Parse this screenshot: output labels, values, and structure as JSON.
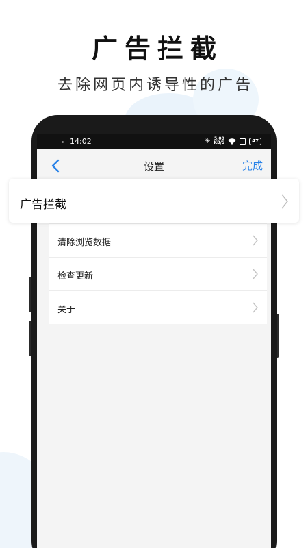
{
  "promo": {
    "title": "广告拦截",
    "subtitle": "去除网页内诱导性的广告"
  },
  "status_bar": {
    "time": "14:02",
    "network_speed_top": "5.00",
    "network_speed_unit": "KB/S",
    "battery": "47"
  },
  "nav": {
    "title": "设置",
    "done_label": "完成"
  },
  "highlight_item": {
    "label": "广告拦截"
  },
  "settings_items": [
    {
      "label": "清除浏览数据"
    },
    {
      "label": "检查更新"
    },
    {
      "label": "关于"
    }
  ],
  "colors": {
    "accent": "#2a83e8",
    "screen_bg": "#f4f4f4",
    "phone_body": "#1a1a1a"
  }
}
